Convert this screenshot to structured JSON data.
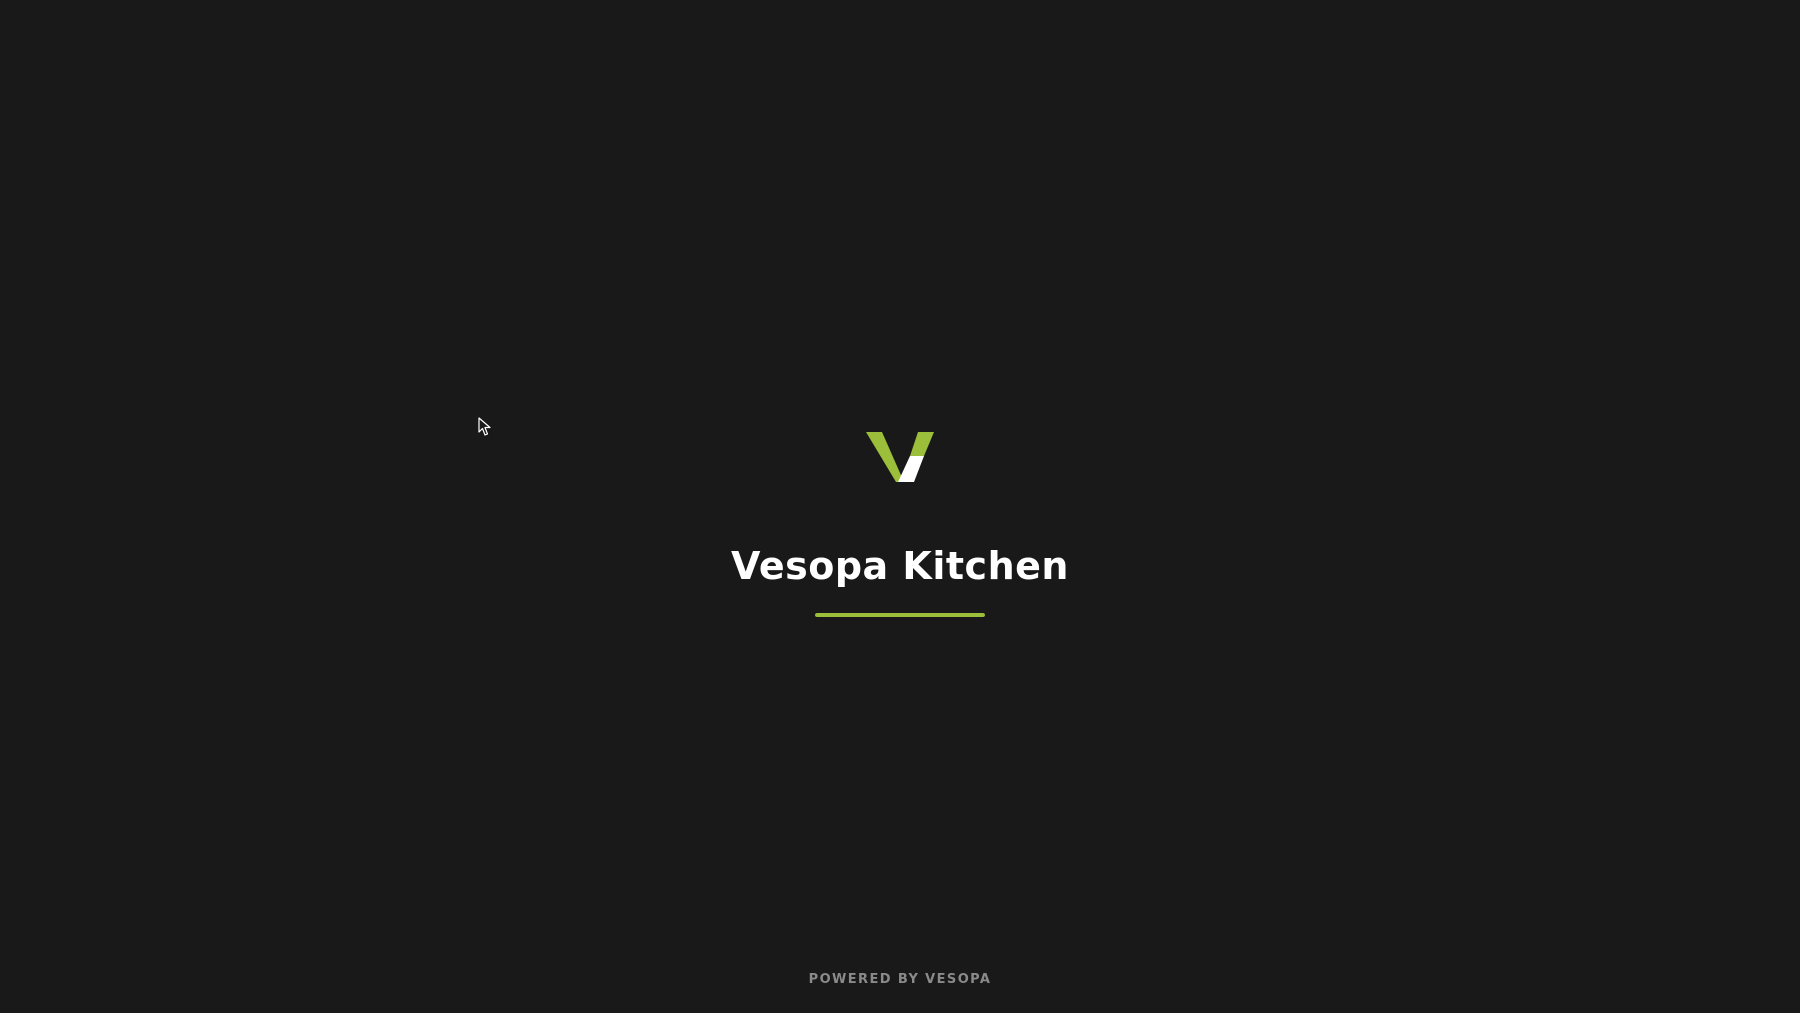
{
  "app": {
    "title": "Vesopa Kitchen",
    "footer": "POWERED BY VESOPA"
  },
  "logo": {
    "icon": "vesopa-v-logo-icon",
    "accent_color": "#9bbe3b",
    "secondary_color": "#ffffff"
  },
  "loading": {
    "progress": 1.0,
    "color": "#9bbe3b"
  },
  "cursor": {
    "icon": "mouse-pointer-icon"
  }
}
